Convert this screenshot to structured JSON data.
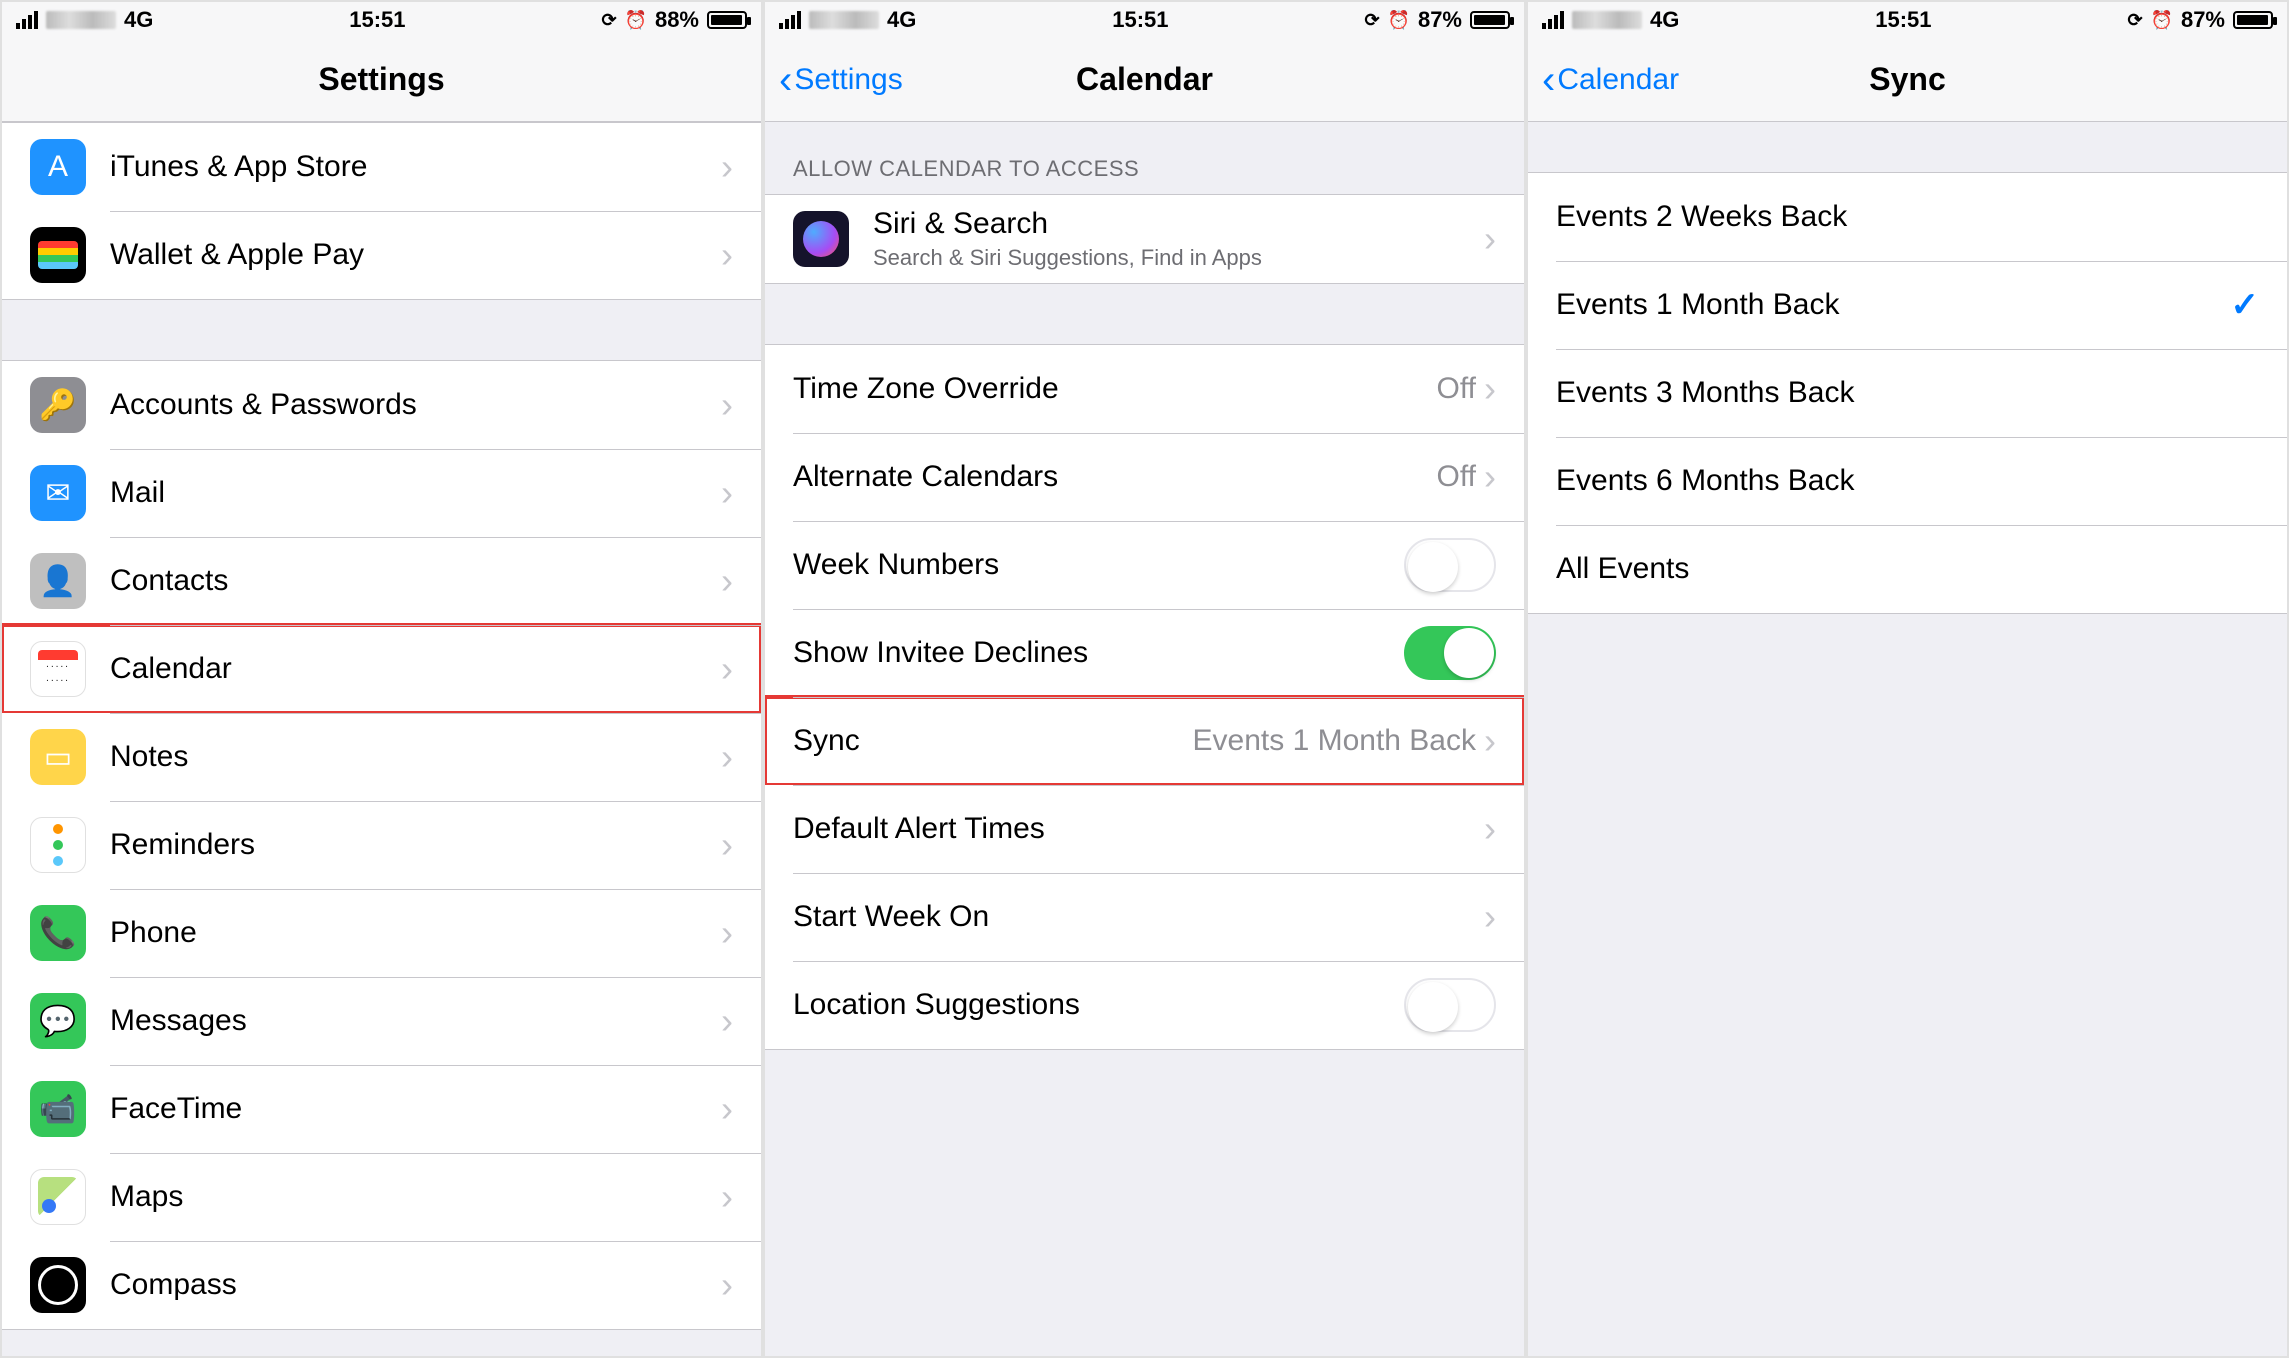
{
  "status": {
    "network": "4G",
    "time": "15:51",
    "battery_screen1": "88%",
    "battery_screen2": "87%",
    "battery_screen3": "87%"
  },
  "screen1": {
    "title": "Settings",
    "groups": [
      {
        "rows": [
          {
            "id": "itunes-app-store",
            "icon": "appstore",
            "glyph": "A",
            "label": "iTunes & App Store"
          },
          {
            "id": "wallet-apple-pay",
            "icon": "wallet",
            "label": "Wallet & Apple Pay"
          }
        ]
      },
      {
        "rows": [
          {
            "id": "accounts-passwords",
            "icon": "accounts",
            "glyph": "🔑",
            "label": "Accounts & Passwords"
          },
          {
            "id": "mail",
            "icon": "mail",
            "glyph": "✉",
            "label": "Mail"
          },
          {
            "id": "contacts",
            "icon": "contacts",
            "glyph": "👤",
            "label": "Contacts"
          },
          {
            "id": "calendar",
            "icon": "calendar",
            "label": "Calendar",
            "highlight": true
          },
          {
            "id": "notes",
            "icon": "notes",
            "glyph": "▭",
            "label": "Notes"
          },
          {
            "id": "reminders",
            "icon": "reminders",
            "label": "Reminders"
          },
          {
            "id": "phone",
            "icon": "phone",
            "glyph": "📞",
            "label": "Phone"
          },
          {
            "id": "messages",
            "icon": "messages",
            "glyph": "💬",
            "label": "Messages"
          },
          {
            "id": "facetime",
            "icon": "facetime",
            "glyph": "📹",
            "label": "FaceTime"
          },
          {
            "id": "maps",
            "icon": "maps",
            "label": "Maps"
          },
          {
            "id": "compass",
            "icon": "compass",
            "label": "Compass"
          }
        ]
      }
    ]
  },
  "screen2": {
    "back": "Settings",
    "title": "Calendar",
    "access_header": "ALLOW CALENDAR TO ACCESS",
    "siri": {
      "label": "Siri & Search",
      "sub": "Search & Siri Suggestions, Find in Apps"
    },
    "rows": [
      {
        "id": "time-zone-override",
        "label": "Time Zone Override",
        "value": "Off",
        "type": "nav"
      },
      {
        "id": "alternate-calendars",
        "label": "Alternate Calendars",
        "value": "Off",
        "type": "nav"
      },
      {
        "id": "week-numbers",
        "label": "Week Numbers",
        "type": "switch",
        "on": false
      },
      {
        "id": "show-invitee-declines",
        "label": "Show Invitee Declines",
        "type": "switch",
        "on": true
      },
      {
        "id": "sync",
        "label": "Sync",
        "value": "Events 1 Month Back",
        "type": "nav",
        "highlight": true
      },
      {
        "id": "default-alert-times",
        "label": "Default Alert Times",
        "type": "nav"
      },
      {
        "id": "start-week-on",
        "label": "Start Week On",
        "type": "nav"
      },
      {
        "id": "location-suggestions",
        "label": "Location Suggestions",
        "type": "switch",
        "on": false
      }
    ]
  },
  "screen3": {
    "back": "Calendar",
    "title": "Sync",
    "options": [
      {
        "id": "events-2-weeks-back",
        "label": "Events 2 Weeks Back",
        "selected": false
      },
      {
        "id": "events-1-month-back",
        "label": "Events 1 Month Back",
        "selected": true
      },
      {
        "id": "events-3-months-back",
        "label": "Events 3 Months Back",
        "selected": false
      },
      {
        "id": "events-6-months-back",
        "label": "Events 6 Months Back",
        "selected": false
      },
      {
        "id": "all-events",
        "label": "All Events",
        "selected": false
      }
    ]
  }
}
